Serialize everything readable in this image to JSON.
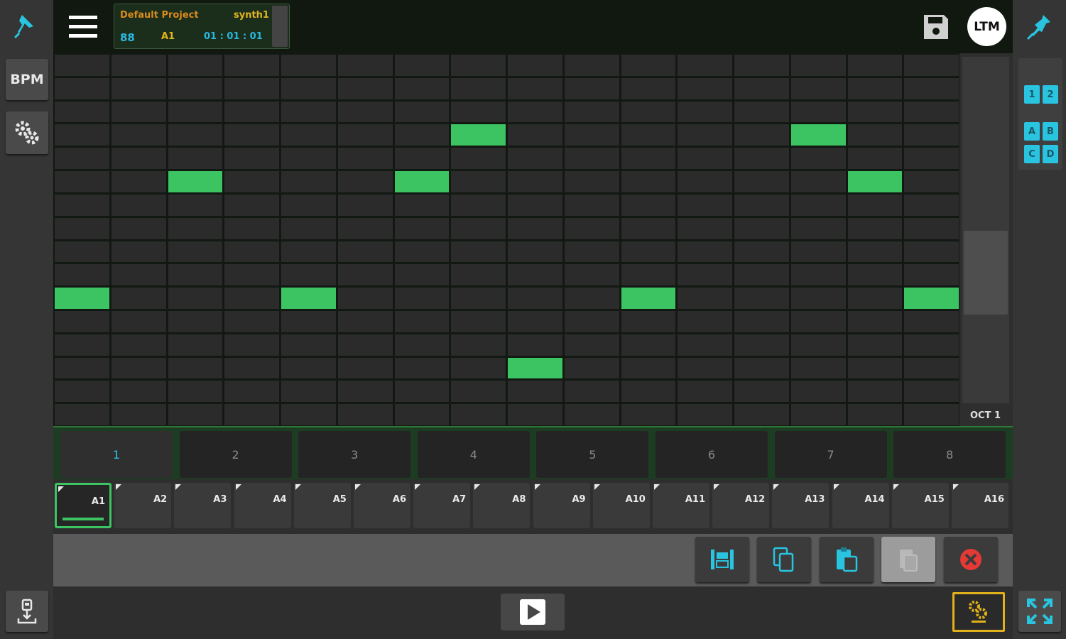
{
  "header": {
    "project_name": "Default Project",
    "instrument": "synth1",
    "tempo": "88",
    "pattern": "A1",
    "position": "01 : 01 : 01"
  },
  "user": {
    "avatar_label": "LTM"
  },
  "left_panel": {
    "bpm_label": "BPM"
  },
  "right_panel": {
    "number_tiles": [
      "1",
      "2"
    ],
    "letter_tiles": [
      "A",
      "B",
      "C",
      "D"
    ]
  },
  "grid": {
    "octave_label": "OCT 1",
    "columns": 16,
    "rows": 16,
    "active_notes": [
      {
        "col": 7,
        "row": 3
      },
      {
        "col": 13,
        "row": 3
      },
      {
        "col": 2,
        "row": 5
      },
      {
        "col": 6,
        "row": 5
      },
      {
        "col": 14,
        "row": 5
      },
      {
        "col": 0,
        "row": 10
      },
      {
        "col": 4,
        "row": 10
      },
      {
        "col": 10,
        "row": 10
      },
      {
        "col": 15,
        "row": 10
      },
      {
        "col": 8,
        "row": 13
      }
    ]
  },
  "steps": [
    "1",
    "2",
    "3",
    "4",
    "5",
    "6",
    "7",
    "8"
  ],
  "active_step": 0,
  "patterns": [
    "A1",
    "A2",
    "A3",
    "A4",
    "A5",
    "A6",
    "A7",
    "A8",
    "A9",
    "A10",
    "A11",
    "A12",
    "A13",
    "A14",
    "A15",
    "A16"
  ],
  "selected_pattern": 0,
  "colors": {
    "note_on": "#3cc463",
    "accent_cyan": "#29c4e0",
    "project_orange": "#d98a1c",
    "instrument_yellow": "#e3b51e",
    "delete_red": "#e53935",
    "tools_gold": "#e0b118"
  },
  "icons": {
    "pin": "pin-icon",
    "settings": "gears-icon",
    "import": "import-icon",
    "menu": "hamburger-icon",
    "save": "floppy-disk-icon",
    "fullscreen": "fullscreen-icon",
    "play": "play-icon",
    "tools": "tools-icon"
  }
}
